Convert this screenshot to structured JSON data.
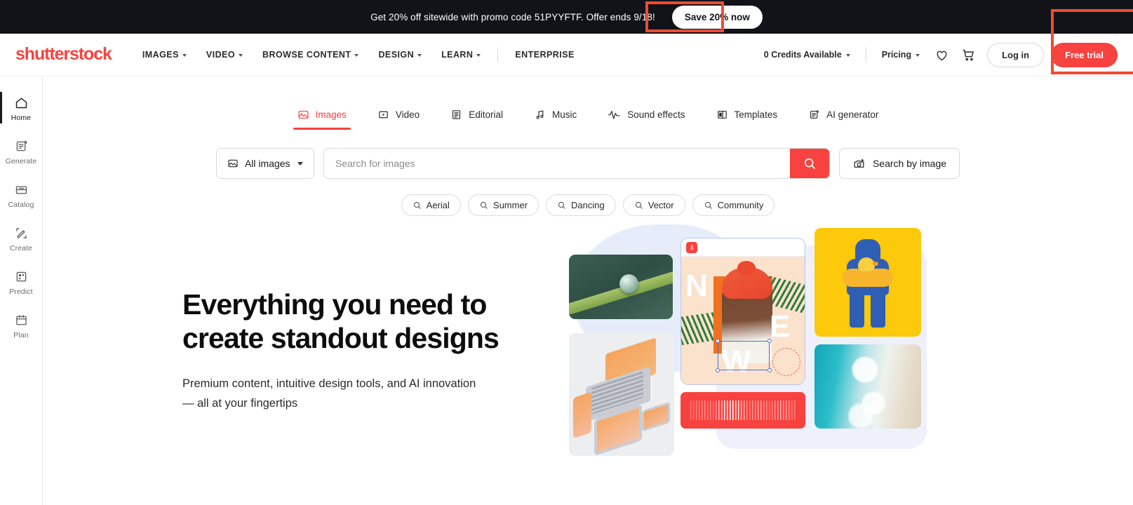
{
  "promo": {
    "text": "Get 20% off sitewide with promo code 51PYYFTF. Offer ends 9/18!",
    "cta": "Save 20% now"
  },
  "header": {
    "logo": "shutterstock",
    "nav": [
      {
        "label": "IMAGES",
        "has_caret": true
      },
      {
        "label": "VIDEO",
        "has_caret": true
      },
      {
        "label": "BROWSE CONTENT",
        "has_caret": true
      },
      {
        "label": "DESIGN",
        "has_caret": true
      },
      {
        "label": "LEARN",
        "has_caret": true
      },
      {
        "label": "ENTERPRISE",
        "has_caret": false
      }
    ],
    "credits": "0 Credits Available",
    "pricing": "Pricing",
    "favorites_icon": "heart-icon",
    "cart_icon": "cart-icon",
    "login": "Log in",
    "free_trial": "Free trial"
  },
  "sidebar": {
    "items": [
      {
        "label": "Home",
        "icon": "home-icon",
        "active": true
      },
      {
        "label": "Generate",
        "icon": "generate-icon",
        "active": false
      },
      {
        "label": "Catalog",
        "icon": "catalog-icon",
        "active": false
      },
      {
        "label": "Create",
        "icon": "create-icon",
        "active": false
      },
      {
        "label": "Predict",
        "icon": "predict-icon",
        "active": false
      },
      {
        "label": "Plan",
        "icon": "plan-icon",
        "active": false
      }
    ]
  },
  "tabs": [
    {
      "label": "Images",
      "icon": "image-icon",
      "active": true
    },
    {
      "label": "Video",
      "icon": "video-icon",
      "active": false
    },
    {
      "label": "Editorial",
      "icon": "editorial-icon",
      "active": false
    },
    {
      "label": "Music",
      "icon": "music-icon",
      "active": false
    },
    {
      "label": "Sound effects",
      "icon": "sound-wave-icon",
      "active": false
    },
    {
      "label": "Templates",
      "icon": "templates-icon",
      "active": false
    },
    {
      "label": "AI generator",
      "icon": "ai-generator-icon",
      "active": false
    }
  ],
  "search": {
    "filter_label": "All images",
    "placeholder": "Search for images",
    "value": "",
    "by_image_label": "Search by image"
  },
  "chips": [
    {
      "label": "Aerial"
    },
    {
      "label": "Summer"
    },
    {
      "label": "Dancing"
    },
    {
      "label": "Vector"
    },
    {
      "label": "Community"
    }
  ],
  "hero": {
    "title_line1": "Everything you need to",
    "title_line2": "create standout designs",
    "subtitle": "Premium content, intuitive design tools, and AI innovation — all at your fingertips"
  },
  "collage": {
    "canvas_letters": {
      "n": "N",
      "e": "E",
      "w": "W"
    }
  },
  "colors": {
    "brand_red": "#f8423f",
    "banner_bg": "#111319",
    "annotation_red": "#f04a32",
    "clay_yellow": "#fcc90b",
    "clay_blue": "#2f5fb5"
  }
}
